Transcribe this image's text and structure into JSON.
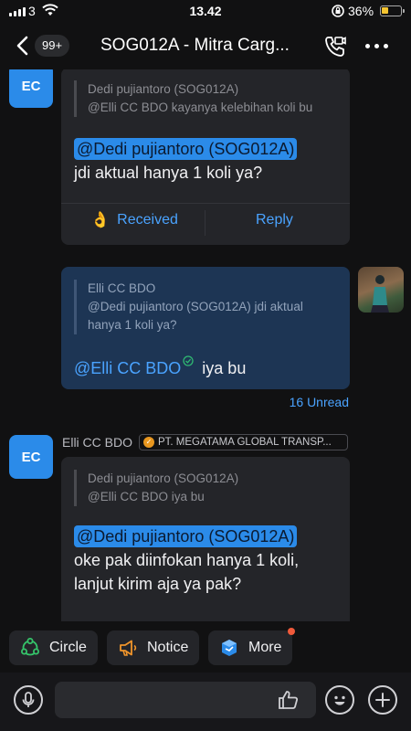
{
  "status_bar": {
    "carrier": "3",
    "time": "13.42",
    "battery_percent": "36%",
    "battery_level": 0.36,
    "icons": [
      "signal-icon",
      "wifi-icon",
      "orientation-lock-icon",
      "battery-icon"
    ]
  },
  "header": {
    "unread_badge": "99+",
    "title": "SOG012A - Mitra Carg...",
    "icons": [
      "back-chevron-icon",
      "video-call-icon",
      "more-dots-icon"
    ]
  },
  "messages": [
    {
      "avatar": "EC",
      "quote_author": "Dedi pujiantoro (SOG012A)",
      "quote_text": "@Elli CC BDO kayanya kelebihan koli bu",
      "mention": "@Dedi pujiantoro (SOG012A)",
      "text": "jdi aktual hanya 1 koli ya?",
      "reaction_label": "Received",
      "reaction_icon": "ok-hand-icon",
      "reply_label": "Reply"
    },
    {
      "quote_author": "Elli CC BDO",
      "quote_text_line1": "@Dedi pujiantoro (SOG012A) jdi aktual",
      "quote_text_line2": "hanya 1 koli ya?",
      "mention": "@Elli CC BDO",
      "text": "iya bu",
      "read_icon": "check-circle-icon",
      "unread_label": "16 Unread"
    },
    {
      "avatar": "EC",
      "sender": "Elli CC BDO",
      "org": "PT. MEGATAMA GLOBAL TRANSP...",
      "quote_author": "Dedi pujiantoro (SOG012A)",
      "quote_text": "@Elli CC BDO iya bu",
      "mention": "@Dedi pujiantoro (SOG012A)",
      "text_line1": "oke pak diinfokan hanya 1 koli,",
      "text_line2": "lanjut kirim aja ya pak?"
    }
  ],
  "quick_actions": [
    {
      "label": "Circle",
      "icon": "circle-icon"
    },
    {
      "label": "Notice",
      "icon": "megaphone-icon"
    },
    {
      "label": "More",
      "icon": "cube-icon"
    }
  ],
  "input": {
    "placeholder": "",
    "icons": [
      "microphone-icon",
      "thumbs-up-icon",
      "emoji-icon",
      "plus-icon"
    ]
  },
  "colors": {
    "accent": "#2b8be9",
    "link": "#4aa3ff",
    "background": "#111112",
    "bubble": "#242529",
    "my_bubble": "#1d3554"
  }
}
